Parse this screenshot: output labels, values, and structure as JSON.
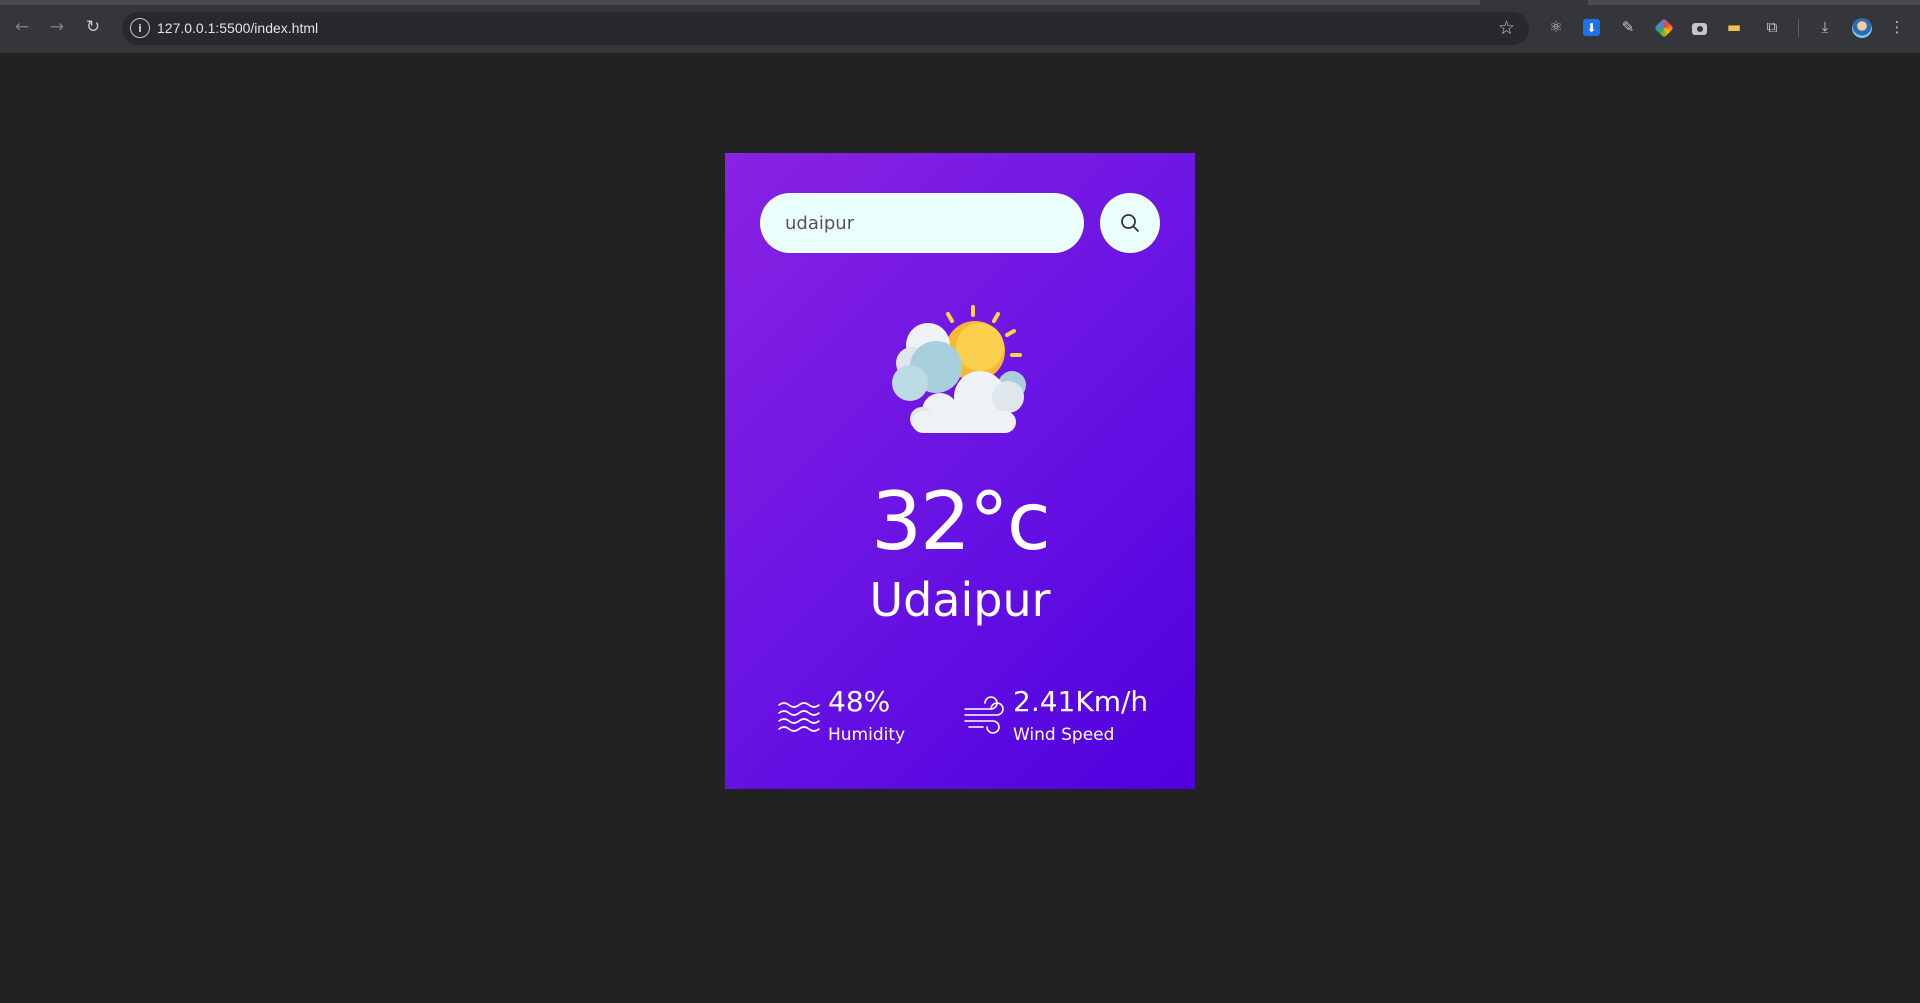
{
  "browser": {
    "url": "127.0.0.1:5500/index.html",
    "icons": {
      "back": "arrow-left-icon",
      "forward": "arrow-right-icon",
      "reload": "reload-icon",
      "site_info": "info-icon",
      "bookmark": "star-icon",
      "extensions": "puzzle-icon",
      "downloads": "download-icon",
      "menu": "kebab-menu-icon"
    }
  },
  "app": {
    "search": {
      "value": "udaipur",
      "placeholder": ""
    },
    "weather_icon": "partly-cloudy-icon",
    "temperature": "32°c",
    "city": "Udaipur",
    "humidity": {
      "value": "48%",
      "label": "Humidity"
    },
    "wind": {
      "value": "2.41Km/h",
      "label": "Wind Speed"
    },
    "colors": {
      "gradient_start": "#8a22e2",
      "gradient_end": "#4f00df",
      "input_bg": "#ebfffc"
    }
  }
}
